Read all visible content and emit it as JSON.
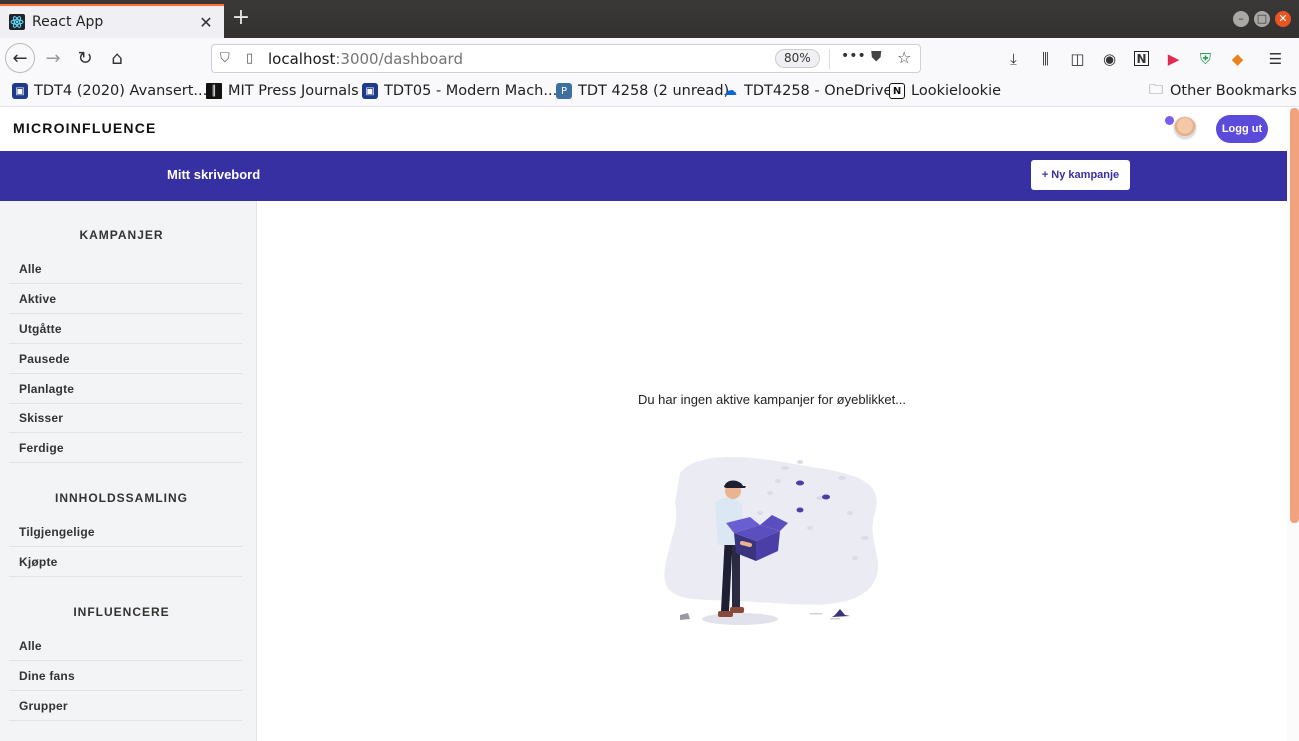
{
  "browser": {
    "tab_title": "React App",
    "new_tab": "+",
    "url_host": "localhost",
    "url_path": ":3000/dashboard",
    "zoom": "80%",
    "bookmarks": [
      "TDT4 (2020) Avansert...",
      "MIT Press Journals",
      "TDT05 - Modern Mach...",
      "TDT 4258 (2 unread)",
      "TDT4258 - OneDrive",
      "Lookielookie"
    ],
    "other_bookmarks": "Other Bookmarks"
  },
  "app": {
    "brand": "MICROINFLUENCE",
    "logout": "Logg ut",
    "banner_title": "Mitt skrivebord",
    "new_campaign": "+ Ny kampanje",
    "empty_message": "Du har ingen aktive kampanjer for øyeblikket..."
  },
  "sidebar": {
    "sections": [
      {
        "title": "KAMPANJER",
        "items": [
          "Alle",
          "Aktive",
          "Utgåtte",
          "Pausede",
          "Planlagte",
          "Skisser",
          "Ferdige"
        ]
      },
      {
        "title": "INNHOLDSSAMLING",
        "items": [
          "Tilgjengelige",
          "Kjøpte"
        ]
      },
      {
        "title": "INFLUENCERE",
        "items": [
          "Alle",
          "Dine fans",
          "Grupper"
        ]
      }
    ]
  },
  "colors": {
    "banner": "#3730a3",
    "logout_button": "#5b4bdb",
    "tab_accent": "#ff7139"
  }
}
